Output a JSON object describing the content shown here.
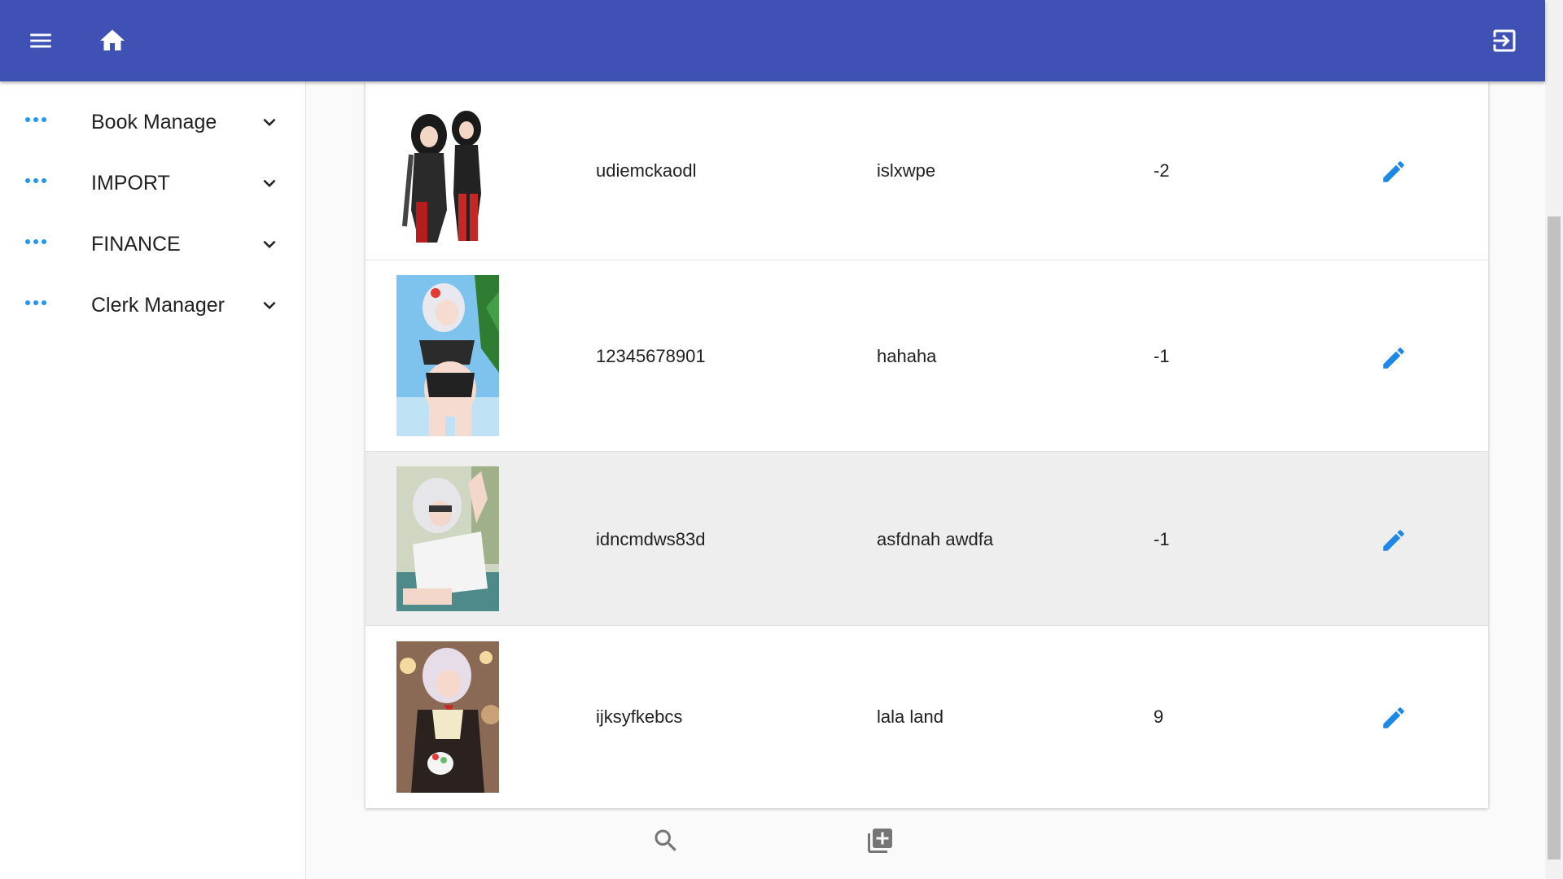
{
  "appbar": {
    "icons": [
      "menu-icon",
      "home-icon",
      "logout-icon"
    ],
    "color": "#3f51b5"
  },
  "sidebar": {
    "items": [
      {
        "label": "Book Manage",
        "icon": "more-horiz-icon"
      },
      {
        "label": "IMPORT",
        "icon": "more-horiz-icon"
      },
      {
        "label": "FINANCE",
        "icon": "more-horiz-icon"
      },
      {
        "label": "Clerk Manager",
        "icon": "more-horiz-icon"
      }
    ],
    "accent": "#2196f3"
  },
  "table": {
    "rows": [
      {
        "id": "udiemckaodl",
        "name": "islxwpe",
        "value": "-2"
      },
      {
        "id": "12345678901",
        "name": "hahaha",
        "value": "-1"
      },
      {
        "id": "idncmdws83d",
        "name": "asfdnah awdfa",
        "value": "-1"
      },
      {
        "id": "ijksyfkebcs",
        "name": "lala land",
        "value": "9"
      }
    ],
    "highlight_color": "#eeeeee",
    "edit_icon_color": "#1e88e5"
  },
  "footer": {
    "icons": [
      "search-icon",
      "library-add-icon"
    ]
  }
}
